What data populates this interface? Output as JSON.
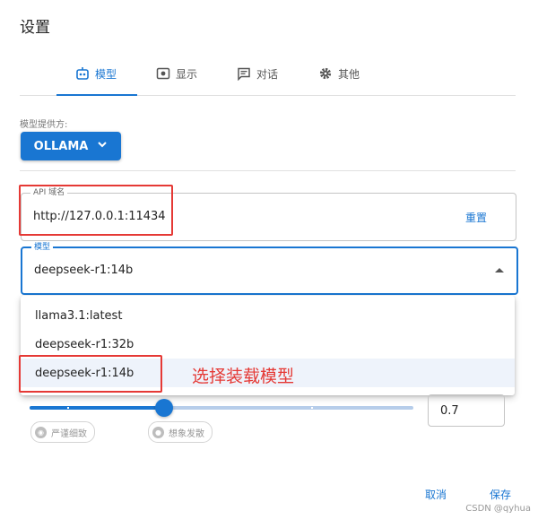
{
  "dialog": {
    "title": "设置"
  },
  "tabs": [
    {
      "label": "模型",
      "icon": "robot-icon",
      "active": true
    },
    {
      "label": "显示",
      "icon": "display-icon"
    },
    {
      "label": "对话",
      "icon": "chat-icon"
    },
    {
      "label": "其他",
      "icon": "gear-icon"
    }
  ],
  "provider": {
    "label": "模型提供方:",
    "value": "OLLAMA"
  },
  "api_host": {
    "label": "API 域名",
    "value": "http://127.0.0.1:11434",
    "reset_label": "重置"
  },
  "model": {
    "label": "模型",
    "value": "deepseek-r1:14b",
    "options": [
      "llama3.1:latest",
      "deepseek-r1:32b",
      "deepseek-r1:14b"
    ],
    "selected_index": 2
  },
  "annotation": "选择装载模型",
  "temperature": {
    "value": "0.7",
    "fraction": 0.35,
    "chip_left": "严谨细致",
    "chip_right": "想象发散"
  },
  "actions": {
    "cancel": "取消",
    "save": "保存"
  },
  "watermark": "CSDN @qyhua",
  "colors": {
    "accent": "#1976d2",
    "annotation_red": "#e53935"
  }
}
